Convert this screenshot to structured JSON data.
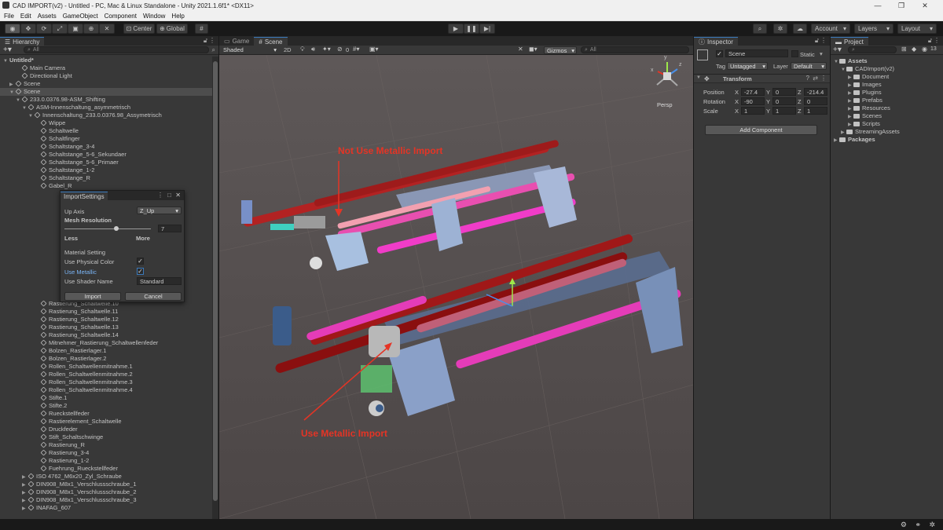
{
  "window": {
    "title": "CAD IMPORT(v2) - Untitled - PC, Mac & Linux Standalone - Unity 2021.1.6f1* <DX11>",
    "minimize": "—",
    "maximize": "❐",
    "close": "✕"
  },
  "menu": [
    "File",
    "Edit",
    "Assets",
    "GameObject",
    "Component",
    "Window",
    "Help"
  ],
  "toolbar": {
    "center": "Center",
    "global": "Global",
    "account": "Account",
    "layers": "Layers",
    "layout": "Layout"
  },
  "hierarchy": {
    "tab": "Hierarchy",
    "search_placeholder": "All",
    "rows": [
      {
        "label": "Untitled*",
        "indent": 0,
        "arrow": "▼",
        "icon": "scene",
        "bold": true
      },
      {
        "label": "Main Camera",
        "indent": 2
      },
      {
        "label": "Directional Light",
        "indent": 2
      },
      {
        "label": "Scene",
        "indent": 1,
        "arrow": "▶"
      },
      {
        "label": "Scene",
        "indent": 1,
        "arrow": "▼",
        "sel": true
      },
      {
        "label": "233.0.0376.98-ASM_Shifting",
        "indent": 2,
        "arrow": "▼"
      },
      {
        "label": "ASM-Innenschaltung_asymmetrisch",
        "indent": 3,
        "arrow": "▼"
      },
      {
        "label": "Innenschaltung_233.0.0376.98_Assymetrisch",
        "indent": 4,
        "arrow": "▼"
      },
      {
        "label": "Wippe",
        "indent": 5
      },
      {
        "label": "Schaltwelle",
        "indent": 5
      },
      {
        "label": "Schaltfinger",
        "indent": 5
      },
      {
        "label": "Schaltstange_3-4",
        "indent": 5
      },
      {
        "label": "Schaltstange_5-6_Sekundaer",
        "indent": 5
      },
      {
        "label": "Schaltstange_5-6_Primaer",
        "indent": 5
      },
      {
        "label": "Schaltstange_1-2",
        "indent": 5
      },
      {
        "label": "Schaltstange_R",
        "indent": 5
      },
      {
        "label": "Gabel_R",
        "indent": 5
      },
      {
        "label": "",
        "indent": 5
      },
      {
        "label": "",
        "indent": 5
      },
      {
        "label": "",
        "indent": 5
      },
      {
        "label": "",
        "indent": 5
      },
      {
        "label": "",
        "indent": 5
      },
      {
        "label": "",
        "indent": 5
      },
      {
        "label": "",
        "indent": 5
      },
      {
        "label": "",
        "indent": 5
      },
      {
        "label": "",
        "indent": 5
      },
      {
        "label": "",
        "indent": 5
      },
      {
        "label": "",
        "indent": 5
      },
      {
        "label": "",
        "indent": 5
      },
      {
        "label": "",
        "indent": 5
      },
      {
        "label": "",
        "indent": 5
      },
      {
        "label": "Rastierung_Schaltwelle.10",
        "indent": 5
      },
      {
        "label": "Rastierung_Schaltwelle.11",
        "indent": 5
      },
      {
        "label": "Rastierung_Schaltwelle.12",
        "indent": 5
      },
      {
        "label": "Rastierung_Schaltwelle.13",
        "indent": 5
      },
      {
        "label": "Rastierung_Schaltwelle.14",
        "indent": 5
      },
      {
        "label": "Mitnehmer_Rastierung_Schaltwellenfeder",
        "indent": 5
      },
      {
        "label": "Bolzen_Rastierlager.1",
        "indent": 5
      },
      {
        "label": "Bolzen_Rastierlager.2",
        "indent": 5
      },
      {
        "label": "Rollen_Schaltwellenmitnahme.1",
        "indent": 5
      },
      {
        "label": "Rollen_Schaltwellenmitnahme.2",
        "indent": 5
      },
      {
        "label": "Rollen_Schaltwellenmitnahme.3",
        "indent": 5
      },
      {
        "label": "Rollen_Schaltwellenmitnahme.4",
        "indent": 5
      },
      {
        "label": "Stifte.1",
        "indent": 5
      },
      {
        "label": "Stifte.2",
        "indent": 5
      },
      {
        "label": "Rueckstellfeder",
        "indent": 5
      },
      {
        "label": "Rastierelement_Schaltwelle",
        "indent": 5
      },
      {
        "label": "Druckfeder",
        "indent": 5
      },
      {
        "label": "Stift_Schaltschwinge",
        "indent": 5
      },
      {
        "label": "Rastierung_R",
        "indent": 5
      },
      {
        "label": "Rastierung_3-4",
        "indent": 5
      },
      {
        "label": "Rastierung_1-2",
        "indent": 5
      },
      {
        "label": "Fuehrung_Rueckstellfeder",
        "indent": 5
      },
      {
        "label": "ISO 4762_M6x20_Zyl_Schraube",
        "indent": 3,
        "arrow": "▶"
      },
      {
        "label": "DIN908_M8x1_Verschlussschraube_1",
        "indent": 3,
        "arrow": "▶"
      },
      {
        "label": "DIN908_M8x1_Verschlussschraube_2",
        "indent": 3,
        "arrow": "▶"
      },
      {
        "label": "DIN908_M8x1_Verschlussschraube_3",
        "indent": 3,
        "arrow": "▶"
      },
      {
        "label": "INAFAG_607",
        "indent": 3,
        "arrow": "▶"
      }
    ]
  },
  "import_dialog": {
    "tab": "ImportSettings",
    "up_axis_label": "Up Axis",
    "up_axis_value": "Z_Up",
    "mesh_resolution_label": "Mesh Resolution",
    "mesh_resolution_value": "7",
    "mesh_resolution_fraction": 0.6,
    "less": "Less",
    "more": "More",
    "material_setting": "Material Setting",
    "use_physical_color": "Use Physical Color",
    "use_metallic": "Use Metallic",
    "use_shader_name": "Use Shader Name",
    "shader_name": "Standard",
    "import_btn": "Import",
    "cancel_btn": "Cancel"
  },
  "scene_view": {
    "tab_game": "Game",
    "tab_scene": "Scene",
    "shading": "Shaded",
    "mode_2d": "2D",
    "gizmos": "Gizmos",
    "search_placeholder": "All",
    "persp": "Persp",
    "hidden_count": "0",
    "annotation_top": "Not Use Metallic Import",
    "annotation_bottom": "Use Metallic Import",
    "axis_y": "y",
    "axis_x": "x",
    "axis_z": "z"
  },
  "inspector": {
    "tab": "Inspector",
    "name": "Scene",
    "static": "Static",
    "tag_label": "Tag",
    "tag_value": "Untagged",
    "layer_label": "Layer",
    "layer_value": "Default",
    "transform": "Transform",
    "position_label": "Position",
    "rotation_label": "Rotation",
    "scale_label": "Scale",
    "position": {
      "x": "-27.4",
      "y": "0",
      "z": "-214.4"
    },
    "rotation": {
      "x": "-90",
      "y": "0",
      "z": "0"
    },
    "scale": {
      "x": "1",
      "y": "1",
      "z": "1"
    },
    "add_component": "Add Component"
  },
  "project": {
    "tab": "Project",
    "badge": "13",
    "rows": [
      {
        "label": "Assets",
        "indent": 0,
        "arrow": "▼",
        "bold": true
      },
      {
        "label": "CADImport(v2)",
        "indent": 1,
        "arrow": "▼"
      },
      {
        "label": "Document",
        "indent": 2,
        "arrow": "▶"
      },
      {
        "label": "Images",
        "indent": 2,
        "arrow": "▶"
      },
      {
        "label": "Plugins",
        "indent": 2,
        "arrow": "▶"
      },
      {
        "label": "Prefabs",
        "indent": 2,
        "arrow": "▶"
      },
      {
        "label": "Resources",
        "indent": 2,
        "arrow": "▶"
      },
      {
        "label": "Scenes",
        "indent": 2,
        "arrow": "▶"
      },
      {
        "label": "Scripts",
        "indent": 2,
        "arrow": "▶"
      },
      {
        "label": "StreamingAssets",
        "indent": 1,
        "arrow": "▶"
      },
      {
        "label": "Packages",
        "indent": 0,
        "arrow": "▶",
        "bold": true
      }
    ]
  }
}
